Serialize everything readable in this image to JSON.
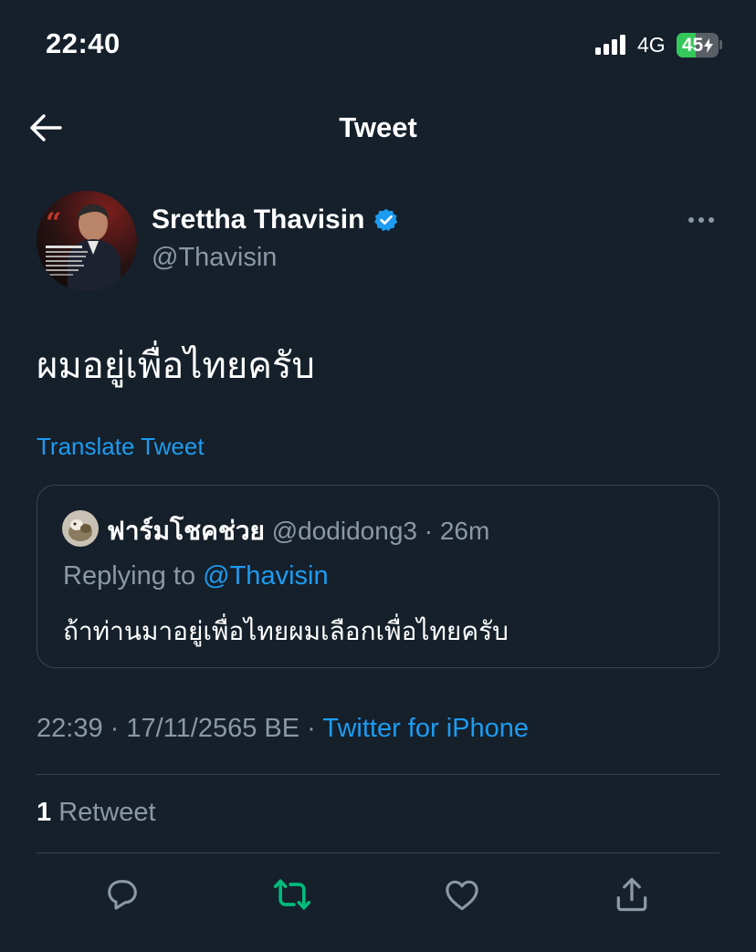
{
  "status_bar": {
    "time": "22:40",
    "network": "4G",
    "battery_level": "45",
    "battery_percent": 45
  },
  "header": {
    "title": "Tweet",
    "back_icon": "arrow-left-icon"
  },
  "tweet": {
    "author": {
      "name": "Srettha Thavisin",
      "handle": "@Thavisin",
      "verified": true
    },
    "text": "ผมอยู่เพื่อไทยครับ",
    "translate_label": "Translate Tweet",
    "quoted": {
      "name": "ฟาร์มโชคช่วย",
      "handle": "@dodidong3",
      "time": "26m",
      "replying_prefix": "Replying to",
      "replying_to": "@Thavisin",
      "text": "ถ้าท่านมาอยู่เพื่อไทยผมเลือกเพื่อไทยครับ"
    },
    "timestamp": "22:39 · 17/11/2565 BE",
    "source": "Twitter for iPhone",
    "retweet_count": "1",
    "retweet_label": "Retweet"
  },
  "actions": [
    {
      "name": "reply-icon"
    },
    {
      "name": "retweet-icon"
    },
    {
      "name": "like-icon"
    },
    {
      "name": "share-icon"
    }
  ],
  "colors": {
    "background": "#15202b",
    "accent": "#1d9bf0",
    "muted": "#8b98a5",
    "divider": "#38444d",
    "retweet_active": "#00ba7c",
    "battery_fill": "#34c759"
  }
}
